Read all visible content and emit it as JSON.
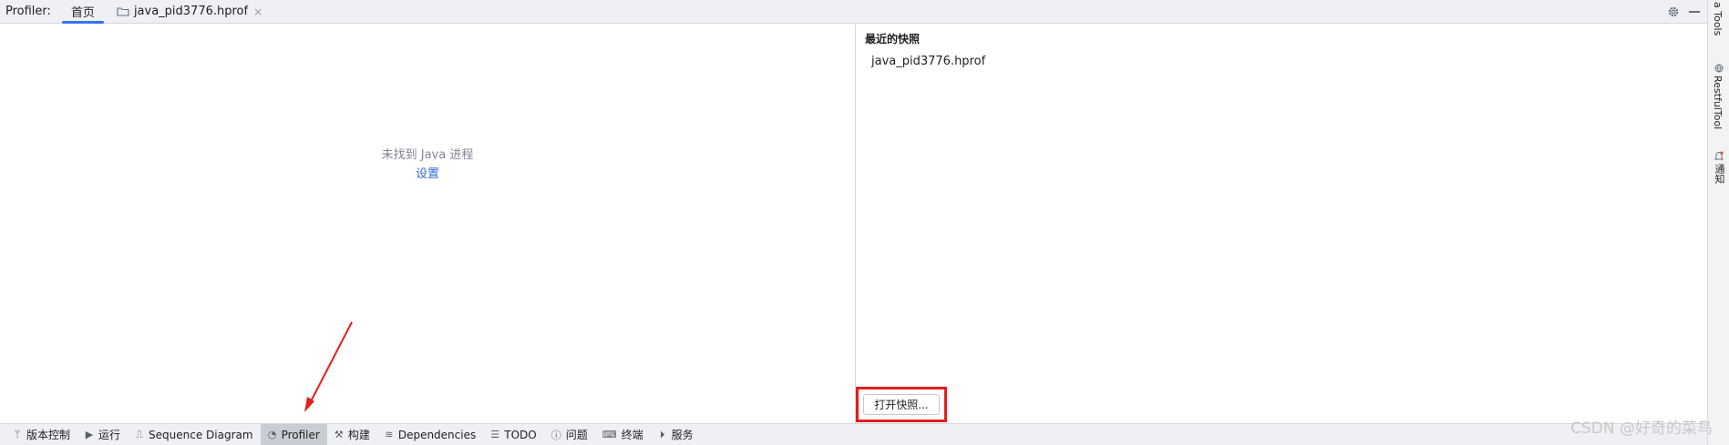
{
  "window": {
    "app_label": "Profiler:",
    "tabs": [
      {
        "label": "首页",
        "active": true
      },
      {
        "label": "java_pid3776.hprof",
        "active": false,
        "closable": true
      }
    ],
    "tab_close_glyph": "×",
    "settings_icon": "gear-icon",
    "minimize_icon": "minimize-icon"
  },
  "right_strip": {
    "items": [
      {
        "label": "a Tools"
      },
      {
        "label": "RestfulTool"
      },
      {
        "label": "通知"
      }
    ]
  },
  "left_panel": {
    "empty_message": "未找到 Java 进程",
    "settings_link": "设置"
  },
  "right_panel": {
    "recent_title": "最近的快照",
    "recent_items": [
      "java_pid3776.hprof"
    ],
    "open_button": "打开快照..."
  },
  "bottom_bar": {
    "items": [
      {
        "label": "版本控制",
        "icon": "branch-icon",
        "glyph": "ᛘ"
      },
      {
        "label": "运行",
        "icon": "run-icon",
        "glyph": "▶"
      },
      {
        "label": "Sequence Diagram",
        "icon": "sequence-diagram-icon",
        "glyph": "⎍"
      },
      {
        "label": "Profiler",
        "icon": "profiler-icon",
        "glyph": "◔",
        "active": true
      },
      {
        "label": "构建",
        "icon": "hammer-icon",
        "glyph": "⚒"
      },
      {
        "label": "Dependencies",
        "icon": "layers-icon",
        "glyph": "≋"
      },
      {
        "label": "TODO",
        "icon": "list-icon",
        "glyph": "☰"
      },
      {
        "label": "问题",
        "icon": "info-icon",
        "glyph": "ⓘ"
      },
      {
        "label": "终端",
        "icon": "terminal-icon",
        "glyph": "⌨"
      },
      {
        "label": "服务",
        "icon": "services-icon",
        "glyph": "⏵"
      }
    ]
  },
  "watermark": "CSDN @好奇的菜鸟",
  "colors": {
    "accent": "#3574f0",
    "link": "#2f6fd6",
    "highlight_box": "#e51c1c",
    "arrow": "#e51c1c"
  }
}
